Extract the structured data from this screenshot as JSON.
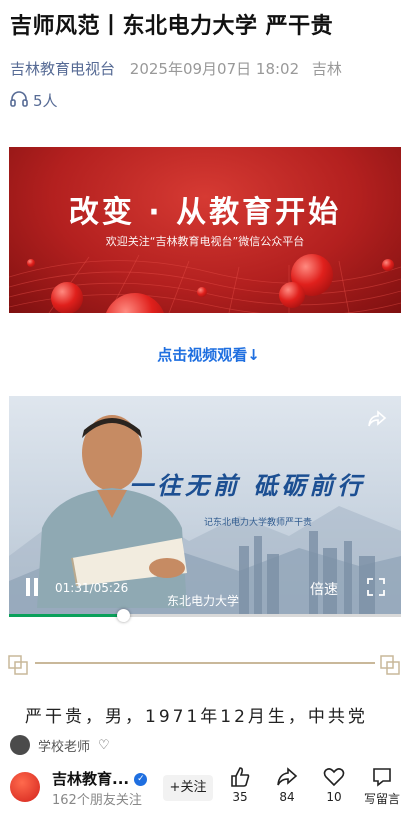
{
  "article": {
    "title": "吉师风范丨东北电力大学 严干贵",
    "account": "吉林教育电视台",
    "date": "2025年09月07日 18:02",
    "location": "吉林",
    "listeners": "5人"
  },
  "banner": {
    "headline": "改变 · 从教育开始",
    "subline": "欢迎关注“吉林教育电视台”微信公众平台"
  },
  "watch_link": "点击视频观看↓",
  "video": {
    "title": "一往无前    砥砺前行",
    "subtitle": "记东北电力大学教师严干贵",
    "time": "01:31/05:26",
    "speed_label": "倍速",
    "university_caption": "东北电力大学",
    "progress": 0.29
  },
  "body_text": "严干贵，男，1971年12月生，中共党",
  "tag_bar": {
    "label": "学校老师"
  },
  "footer": {
    "account_name": "吉林教育...",
    "account_sub": "162个朋友关注",
    "follow_label": "+关注",
    "like_count": "35",
    "share_count": "84",
    "favorite_count": "10",
    "comment_label": "写留言"
  },
  "colors": {
    "link": "#576b95",
    "accent_blue": "#1f6fe0",
    "banner_red": "#b3201f",
    "progress_green": "#0aa05a"
  }
}
